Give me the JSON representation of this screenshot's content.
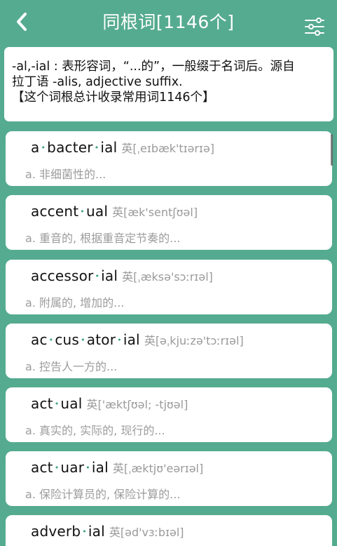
{
  "header": {
    "title": "同根词[1146个]",
    "back_icon": "chevron-left-icon",
    "filter_icon": "sliders-icon"
  },
  "intro": {
    "line1": "-al,-ial : 表形容词，“...的”，一般缀于名词后。源自",
    "line2": "拉丁语 -alis, adjective suffix.",
    "line3": "【这个词根总计收录常用词1146个】"
  },
  "words": [
    {
      "parts": [
        "a",
        "bacter",
        "ial"
      ],
      "phon": "英[ˌeɪbæk'tɪərɪə]",
      "meaning": "a. 非细菌性的..."
    },
    {
      "parts": [
        "accent",
        "ual"
      ],
      "phon": "英[æk'sentʃʊəl]",
      "meaning": "a. 重音的, 根据重音定节奏的..."
    },
    {
      "parts": [
        "accessor",
        "ial"
      ],
      "phon": "英[ˌæksə'sɔːrɪəl]",
      "meaning": "a. 附属的, 增加的..."
    },
    {
      "parts": [
        "ac",
        "cus",
        "ator",
        "ial"
      ],
      "phon": "英[əˌkjuːzə'tɔːrɪəl]",
      "meaning": "a. 控告人一方的..."
    },
    {
      "parts": [
        "act",
        "ual"
      ],
      "phon": "英['æktʃʊəl; -tjʊəl]",
      "meaning": "a. 真实的, 实际的, 现行的..."
    },
    {
      "parts": [
        "act",
        "uar",
        "ial"
      ],
      "phon": "英[ˌæktjʊ'eərɪəl]",
      "meaning": "a. 保险计算员的, 保险计算的..."
    },
    {
      "parts": [
        "adverb",
        "ial"
      ],
      "phon": "英[əd'vɜːbɪəl]",
      "meaning": ""
    }
  ],
  "colors": {
    "background": "#55ab8f",
    "card": "#ffffff",
    "syllable_dot": "#3ba37f",
    "muted_text": "#9c9c9c"
  }
}
